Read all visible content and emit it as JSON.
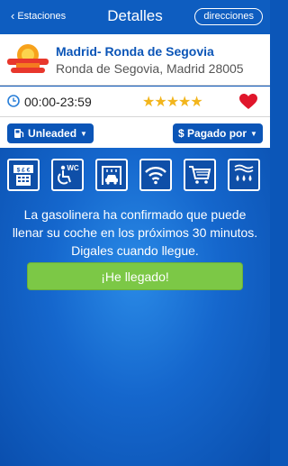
{
  "nav": {
    "back_label": "Estaciones",
    "title": "Detalles",
    "directions_label": "direcciones"
  },
  "station": {
    "name": "Madrid- Ronda de Segovia",
    "address": "Ronda de Segovia, Madrid 28005"
  },
  "info": {
    "hours": "00:00-23:59",
    "rating": 5,
    "stars": "★★★★★",
    "favorite": true
  },
  "filters": {
    "fuel_label": "Unleaded",
    "payment_label": "$ Pagado por"
  },
  "amenities": [
    {
      "name": "atm",
      "badge": "$ £ €"
    },
    {
      "name": "accessible-wc",
      "badge": "WC"
    },
    {
      "name": "car-wash"
    },
    {
      "name": "wifi"
    },
    {
      "name": "shop-cart"
    },
    {
      "name": "water-air"
    }
  ],
  "message": "La gasolinera ha confirmado que puede llenar su coche en los próximos 30 minutos. Digales cuando llegue.",
  "arrived_button": "¡He llegado!",
  "colors": {
    "brand_blue": "#0b55b7",
    "star": "#f2b51c",
    "heart": "#e0162b",
    "arrived_green": "#7cc846"
  }
}
